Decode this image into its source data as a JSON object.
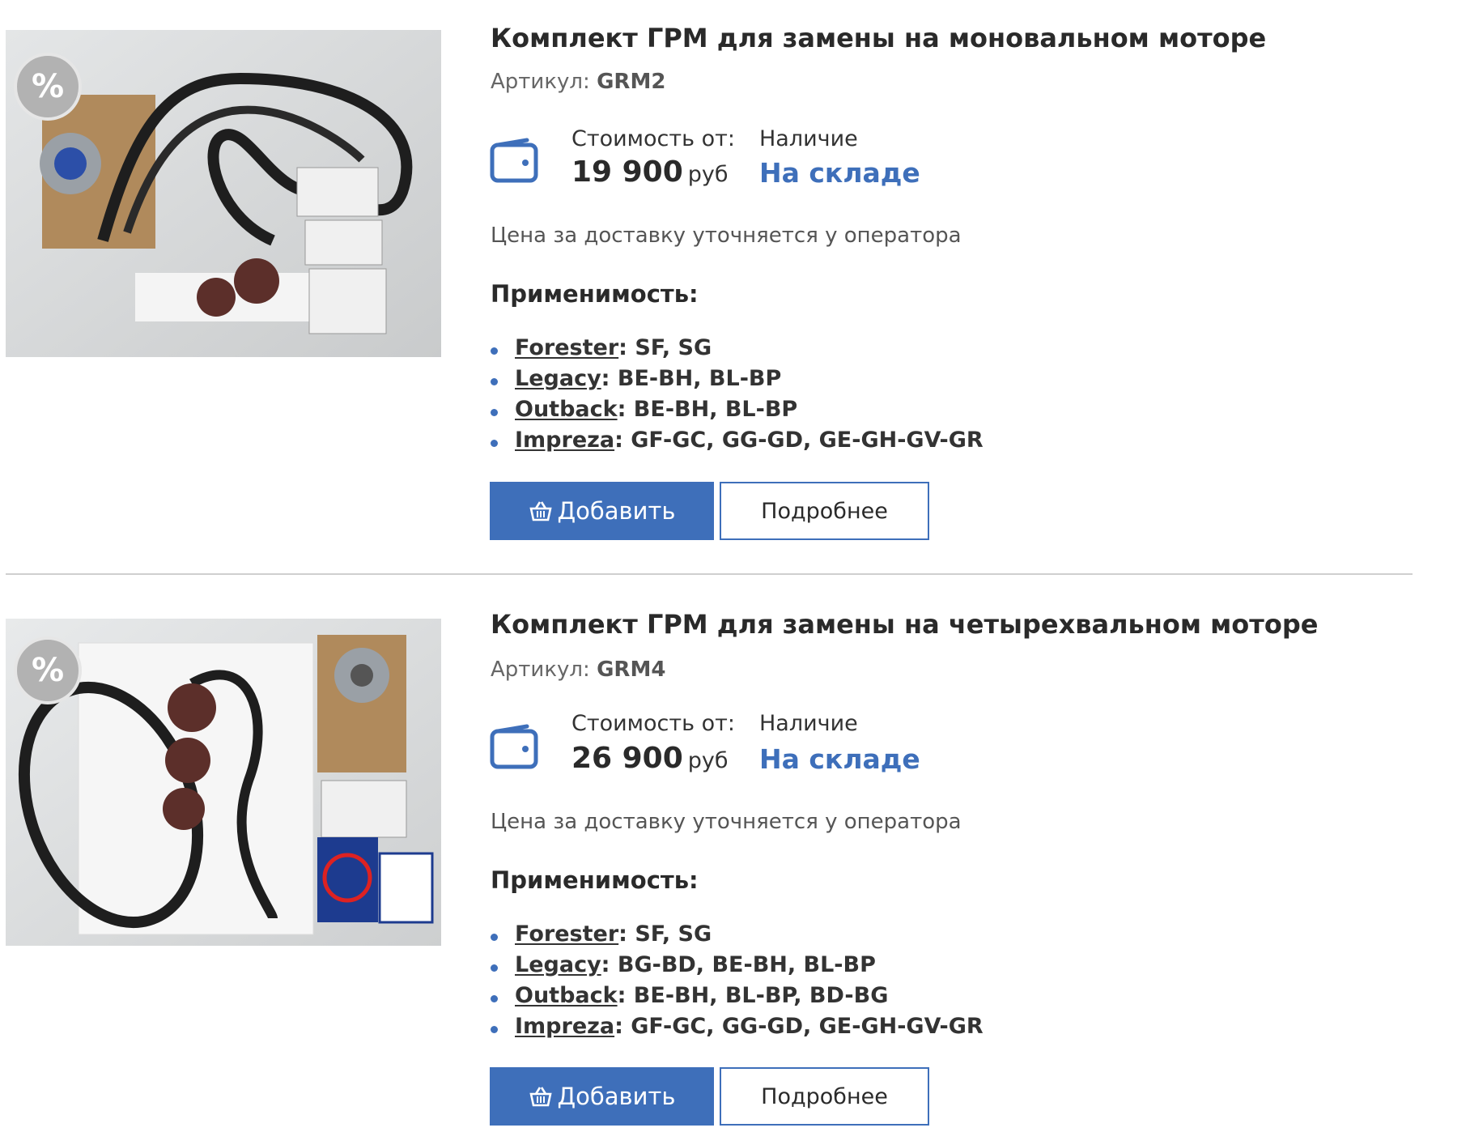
{
  "colors": {
    "accent": "#3e6fba",
    "divider": "#cfcfcf",
    "badge": "#b2b2b2"
  },
  "products": [
    {
      "badge_icon": "percent-icon",
      "badge": "%",
      "title": "Комплект ГРМ для замены на моновальном моторе",
      "sku_label": "Артикул:",
      "sku": "GRM2",
      "price_label": "Стоимость от:",
      "price": "19 900",
      "currency": "руб",
      "stock_label": "Наличие",
      "stock": "На складе",
      "delivery_note": "Цена за доставку уточняется у оператора",
      "applicability_title": "Применимость:",
      "applicability": [
        {
          "model": "Forester",
          "bodies": ": SF, SG"
        },
        {
          "model": "Legacy",
          "bodies": ": BE-BH, BL-BP"
        },
        {
          "model": "Outback",
          "bodies": ": BE-BH, BL-BP"
        },
        {
          "model": "Impreza",
          "bodies": ": GF-GC, GG-GD, GE-GH-GV-GR"
        }
      ],
      "add_label": "Добавить",
      "add_icon": "basket-icon",
      "more_label": "Подробнее"
    },
    {
      "badge_icon": "percent-icon",
      "badge": "%",
      "title": "Комплект ГРМ для замены на четырехвальном моторе",
      "sku_label": "Артикул:",
      "sku": "GRM4",
      "price_label": "Стоимость от:",
      "price": "26 900",
      "currency": "руб",
      "stock_label": "Наличие",
      "stock": "На складе",
      "delivery_note": "Цена за доставку уточняется у оператора",
      "applicability_title": "Применимость:",
      "applicability": [
        {
          "model": "Forester",
          "bodies": ": SF, SG"
        },
        {
          "model": "Legacy",
          "bodies": ": BG-BD, BE-BH, BL-BP"
        },
        {
          "model": "Outback",
          "bodies": ": BE-BH, BL-BP, BD-BG"
        },
        {
          "model": "Impreza",
          "bodies": ": GF-GC, GG-GD, GE-GH-GV-GR"
        }
      ],
      "add_label": "Добавить",
      "add_icon": "basket-icon",
      "more_label": "Подробнее"
    }
  ]
}
